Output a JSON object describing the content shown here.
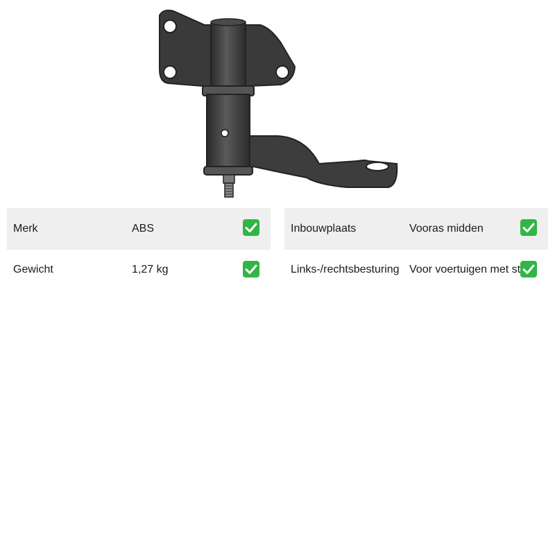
{
  "specs_left": [
    {
      "label": "Merk",
      "value": "ABS",
      "icon": "check-icon"
    },
    {
      "label": "Gewicht",
      "value": "1,27 kg",
      "icon": "check-icon"
    }
  ],
  "specs_right": [
    {
      "label": "Inbouwplaats",
      "value": "Vooras midden",
      "icon": "check-icon"
    },
    {
      "label": "Links-/rechtsbesturing",
      "value": "Voor voertuigen met stuur",
      "icon": "check-icon"
    }
  ],
  "colors": {
    "row_shade": "#efefef",
    "check_green": "#31b545"
  }
}
